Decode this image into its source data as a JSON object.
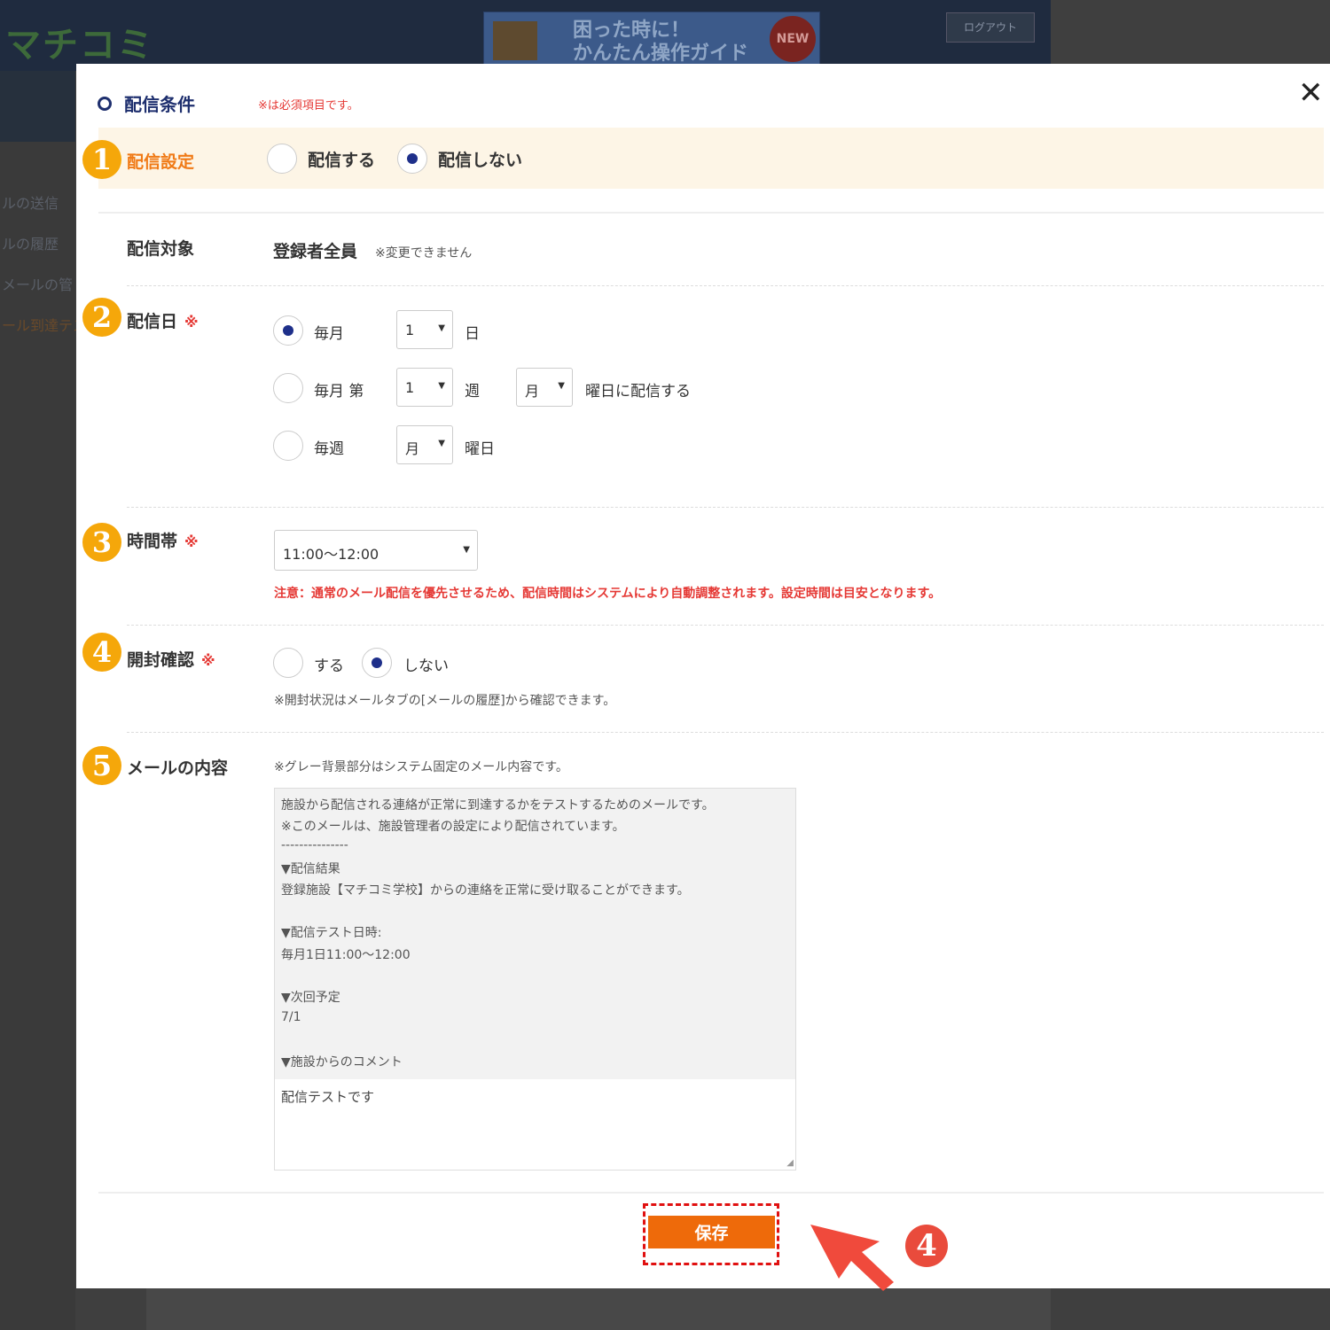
{
  "background": {
    "logo": "マチコミ",
    "banner": {
      "line1": "困った時に！",
      "line2": "かんたん操作ガイド",
      "badge": "NEW"
    },
    "logout": "ログアウト",
    "sidebar": [
      "ルの送信",
      "ルの履歴",
      "メールの管",
      "ール到達テス"
    ]
  },
  "modal": {
    "title": "配信条件",
    "required_note": "※は必須項目です。",
    "required_mark": "※",
    "sections": {
      "delivery_setting": {
        "number": "1",
        "label": "配信設定",
        "options": [
          "配信する",
          "配信しない"
        ],
        "selected": "配信しない"
      },
      "target": {
        "label": "配信対象",
        "value": "登録者全員",
        "note": "※変更できません"
      },
      "delivery_date": {
        "number": "2",
        "label": "配信日",
        "monthly": {
          "label": "毎月",
          "day": "1",
          "suffix": "日"
        },
        "monthly_week": {
          "label": "毎月 第",
          "week": "1",
          "week_suffix": "週",
          "weekday": "月",
          "suffix": "曜日に配信する"
        },
        "weekly": {
          "label": "毎週",
          "weekday": "月",
          "suffix": "曜日"
        },
        "selected": "毎月"
      },
      "time_slot": {
        "number": "3",
        "label": "時間帯",
        "value": "11:00〜12:00",
        "note": "注意：通常のメール配信を優先させるため、配信時間はシステムにより自動調整されます。設定時間は目安となります。"
      },
      "open_check": {
        "number": "4",
        "label": "開封確認",
        "options": [
          "する",
          "しない"
        ],
        "selected": "しない",
        "note": "※開封状況はメールタブの[メールの履歴]から確認できます。"
      },
      "mail_content": {
        "number": "5",
        "label": "メールの内容",
        "note": "※グレー背景部分はシステム固定のメール内容です。",
        "fixed_lines": [
          "施設から配信される連絡が正常に到達するかをテストするためのメールです。",
          "※このメールは、施設管理者の設定により配信されています。",
          "---------------",
          "▼配信結果",
          "登録施設【マチコミ学校】からの連絡を正常に受け取ることができます。",
          "",
          "▼配信テスト日時:",
          "毎月1日11:00〜12:00",
          "",
          "▼次回予定",
          "7/1",
          "",
          "▼施設からのコメント"
        ],
        "comment": "配信テストです"
      }
    },
    "save_label": "保存",
    "step_badge": "4"
  },
  "colors": {
    "accent_orange": "#ee6a0a",
    "badge_yellow": "#f5a70a",
    "required_red": "#e53935",
    "title_navy": "#1e2f6e"
  }
}
